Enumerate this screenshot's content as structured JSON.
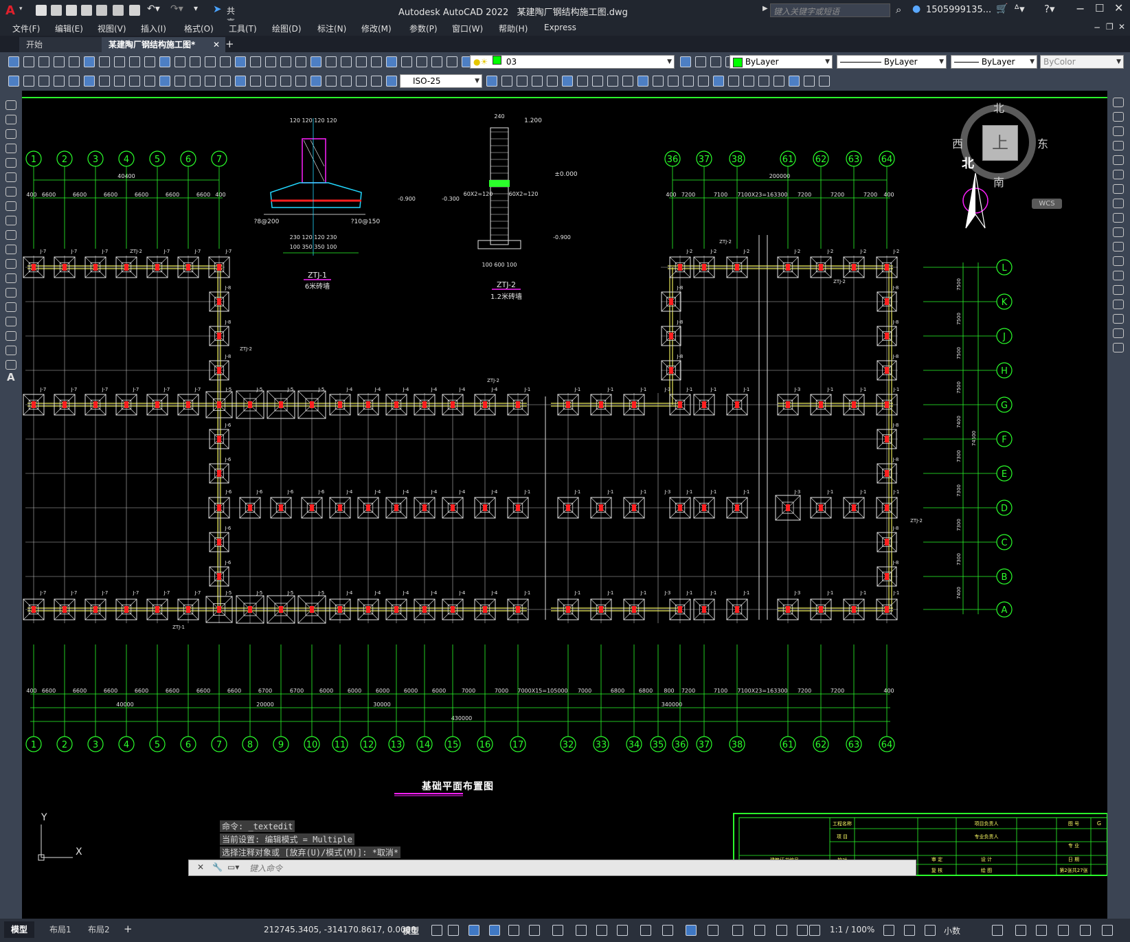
{
  "window": {
    "app_title": "Autodesk AutoCAD 2022",
    "file_title": "某建陶厂钢结构施工图.dwg",
    "share_label": "共享",
    "search_placeholder": "键入关键字或短语",
    "user_label": "1505999135...",
    "app_logo": "A"
  },
  "menu": [
    "文件(F)",
    "编辑(E)",
    "视图(V)",
    "插入(I)",
    "格式(O)",
    "工具(T)",
    "绘图(D)",
    "标注(N)",
    "修改(M)",
    "参数(P)",
    "窗口(W)",
    "帮助(H)",
    "Express"
  ],
  "tabs": [
    {
      "label": "开始",
      "active": false
    },
    {
      "label": "某建陶厂钢结构施工图*",
      "active": true
    }
  ],
  "toolbar": {
    "layer_value": "03",
    "color_value": "ByLayer",
    "linetype_value": "ByLayer",
    "lineweight_value": "ByLayer",
    "plotstyle_value": "ByColor",
    "dimstyle_value": "ISO-25"
  },
  "viewcube": {
    "north": "北",
    "south": "南",
    "east": "东",
    "west": "西",
    "top": "上",
    "wcs": "WCS",
    "north_arrow": "北"
  },
  "drawing": {
    "title": "基础平面布置图",
    "top_axes_left": [
      "1",
      "2",
      "3",
      "4",
      "5",
      "6",
      "7"
    ],
    "top_axes_right": [
      "36",
      "37",
      "38",
      "61",
      "62",
      "63",
      "64"
    ],
    "bottom_axes": [
      "1",
      "2",
      "3",
      "4",
      "5",
      "6",
      "7",
      "8",
      "9",
      "10",
      "11",
      "12",
      "13",
      "14",
      "15",
      "16",
      "17",
      "32",
      "33",
      "34",
      "35",
      "36",
      "37",
      "38",
      "61",
      "62",
      "63",
      "64"
    ],
    "row_axes": [
      "L",
      "K",
      "J",
      "H",
      "G",
      "F",
      "E",
      "D",
      "C",
      "B",
      "A"
    ],
    "top_dim_left_total": "40400",
    "top_dim_right_total": "200000",
    "top_dims_left": [
      "400",
      "6600",
      "6600",
      "6600",
      "6600",
      "6600",
      "6600",
      "400"
    ],
    "top_dims_right": [
      "400",
      "7200",
      "7100",
      "7100X23=163300",
      "7200",
      "7200",
      "7200",
      "400"
    ],
    "bottom_dims_row1": [
      "400",
      "6600",
      "6600",
      "6600",
      "6600",
      "6600",
      "6600",
      "6600",
      "6700",
      "6700",
      "6000",
      "6000",
      "6000",
      "6000",
      "6000",
      "7000",
      "7000",
      "7000X15=105000",
      "7000",
      "6800",
      "6800",
      "800",
      "7200",
      "7100",
      "7100X23=163300",
      "7200",
      "7200",
      "400"
    ],
    "bottom_dims_row2": [
      "40000",
      "20000",
      "30000",
      "340000"
    ],
    "bottom_dim_total": "430000",
    "row_dims": [
      "7500",
      "7500",
      "7500",
      "7500",
      "7400",
      "7300",
      "7300",
      "7300",
      "7300",
      "7400"
    ],
    "row_dim_total": "74500",
    "detail1_label": "ZTJ-1",
    "detail1_sub": "6米砖墙",
    "detail2_label": "ZTJ-2",
    "detail2_sub": "1.2米砖墙",
    "detail_texts": [
      "120",
      "120",
      "120",
      "120",
      "?8@200",
      "?10@150",
      "230",
      "120",
      "120",
      "230",
      "100",
      "350",
      "350",
      "100",
      "-0.900",
      "240",
      "1.200",
      "±0.000",
      "60X2=120",
      "60X2=120",
      "-0.300",
      "-0.900",
      "100",
      "600",
      "100"
    ],
    "foundation_tags": [
      "J-7",
      "J-2",
      "J-5",
      "J-4",
      "J-1",
      "J-3",
      "J-6",
      "J-8",
      "ZTJ-2",
      "ZTJ-1"
    ]
  },
  "title_block": {
    "rows": [
      "工程名称",
      "项 目",
      "基础平面布置图",
      "审 定",
      "复 核",
      "设 计",
      "绘 图",
      "日 期",
      "专 业",
      "图 号",
      "第2张共27张",
      "G"
    ],
    "cells": [
      "项目负责人",
      "专业负责人",
      "校对",
      "建筑证书编号"
    ]
  },
  "command": {
    "history": [
      "命令: _textedit",
      "当前设置: 编辑模式 = Multiple",
      "选择注释对象或 [放弃(U)/模式(M)]: *取消*"
    ],
    "placeholder": "键入命令"
  },
  "ucs": {
    "x_label": "X",
    "y_label": "Y"
  },
  "layout_tabs": [
    "模型",
    "布局1",
    "布局2"
  ],
  "status": {
    "coords": "212745.3405, -314170.8617, 0.0000",
    "space": "模型",
    "scale": "1:1 / 100%",
    "units": "小数"
  },
  "colors": {
    "grid_green": "#2bff2b",
    "beam_yellow": "#e8e85a",
    "foundation_white": "#e6e6e6",
    "rebar_red": "#ff2020",
    "cyan": "#22d8ff",
    "magenta": "#ff20ff",
    "titlebar": "#21262f",
    "toolbar": "#3b4453"
  }
}
